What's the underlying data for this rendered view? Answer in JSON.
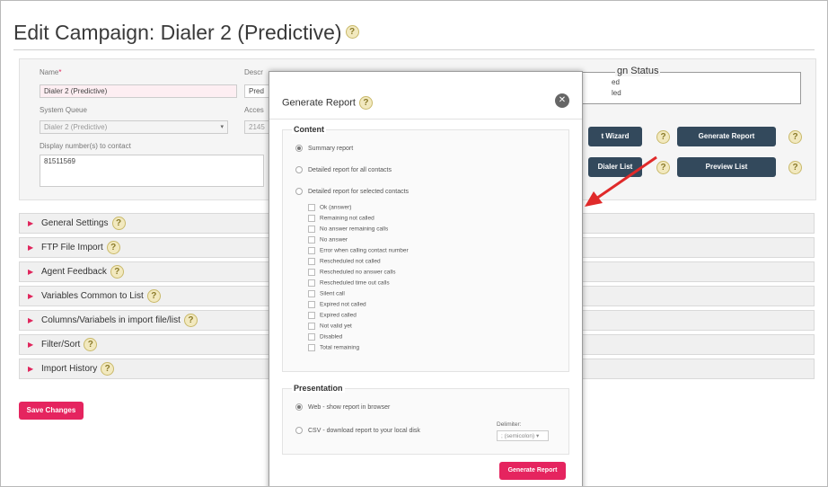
{
  "page": {
    "title": "Edit Campaign: Dialer 2 (Predictive)"
  },
  "form": {
    "name_label": "Name",
    "name_required": "*",
    "name_value": "Dialer 2 (Predictive)",
    "desc_label": "Descr",
    "desc_value": "Pred",
    "queue_label": "System Queue",
    "queue_value": "Dialer 2 (Predictive)",
    "access_label": "Acces",
    "access_value": "2145",
    "display_label": "Display number(s) to contact",
    "display_value": "81511569"
  },
  "status": {
    "title": "gn Status",
    "line1": "ed",
    "line2": "led"
  },
  "buttons": {
    "wizard": "t Wizard",
    "generate_report": "Generate Report",
    "dialer_list": "Dialer List",
    "preview_list": "Preview List",
    "save_changes": "Save Changes"
  },
  "sections": [
    {
      "label": "General Settings"
    },
    {
      "label": "FTP File Import"
    },
    {
      "label": "Agent Feedback"
    },
    {
      "label": "Variables Common to List"
    },
    {
      "label": "Columns/Variabels in import file/list"
    },
    {
      "label": "Filter/Sort"
    },
    {
      "label": "Import History"
    }
  ],
  "modal": {
    "title": "Generate Report",
    "content_legend": "Content",
    "report_options": [
      "Summary report",
      "Detailed report for all contacts",
      "Detailed report for selected contacts"
    ],
    "contact_filters": [
      "Ok (answer)",
      "Remaining not called",
      "No answer remaining calls",
      "No answer",
      "Error when calling contact number",
      "Rescheduled not called",
      "Rescheduled no answer calls",
      "Rescheduled time out calls",
      "Silent call",
      "Expired not called",
      "Expired called",
      "Not valid yet",
      "Disabled",
      "Total remaining"
    ],
    "presentation_legend": "Presentation",
    "presentation_options": [
      "Web - show report in browser",
      "CSV - download report to your local disk"
    ],
    "delimiter_label": "Delimiter:",
    "delimiter_value": "; (semicolon)",
    "generate_button": "Generate Report"
  },
  "colors": {
    "accent": "#e5245f",
    "dark_button": "#33495c",
    "arrow": "#e02a2a"
  }
}
